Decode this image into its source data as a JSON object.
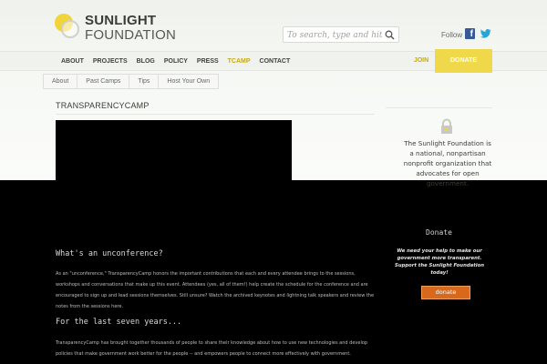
{
  "brand": {
    "line1": "SUNLIGHT",
    "line2": "FOUNDATION"
  },
  "search": {
    "placeholder": "To search, type and hit ente"
  },
  "social": {
    "follow_label": "Follow Us"
  },
  "nav": {
    "items": [
      "ABOUT",
      "PROJECTS",
      "BLOG",
      "POLICY",
      "PRESS",
      "TCAMP",
      "CONTACT"
    ],
    "active": "TCAMP",
    "join_label": "JOIN",
    "donate_label": "DONATE"
  },
  "subnav": {
    "items": [
      "About",
      "Past Camps",
      "Tips",
      "Host Your Own"
    ]
  },
  "page": {
    "title": "TRANSPARENCYCAMP"
  },
  "sidebar": {
    "description": "The Sunlight Foundation is a national, nonpartisan nonprofit organization that advocates for open government.",
    "donate_heading": "Donate",
    "donate_text": "We need your help to make our government more transparent. Support the Sunlight Foundation today!",
    "donate_button": "donate"
  },
  "content": {
    "heading1": "What's an unconference?",
    "para1": "As an \"unconference,\" TransparencyCamp honors the important contributions that each and every attendee brings to the sessions, workshops and conversations that make up this event. Attendees (yes, all of them!) help create the schedule for the conference and are encouraged to sign up and lead sessions themselves. Still unsure? Watch the archived keynotes and lightning talk speakers and review the notes from the sessions here.",
    "heading2": "For the last seven years...",
    "para2": "TransparencyCamp has brought together thousands of people to share their knowledge about how to use new technologies and develop policies that make government work better for the people -- and empowers people to connect more effectively with government."
  },
  "colors": {
    "accent": "#efd84a",
    "active_nav": "#c9a80f",
    "sidebar_donate": "#d8691c",
    "facebook": "#3a5a97",
    "twitter": "#2aa3d8"
  }
}
